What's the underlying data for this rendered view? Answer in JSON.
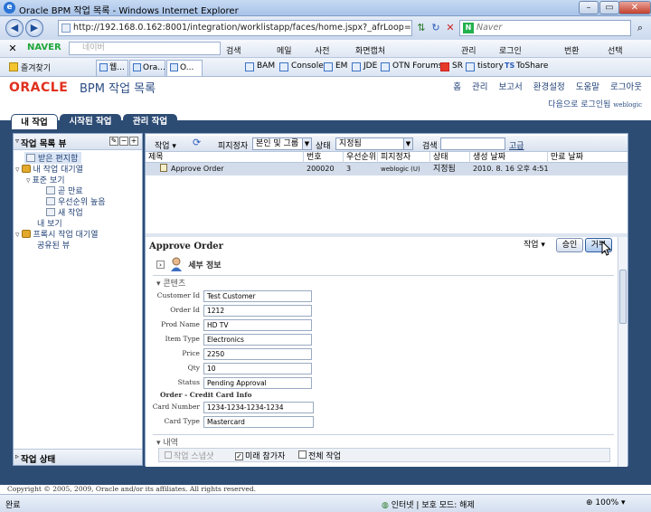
{
  "window": {
    "title": "Oracle BPM 작업 목록 - Windows Internet Explorer"
  },
  "browser": {
    "address": "http://192.168.0.162:8001/integration/worklistapp/faces/home.jspx?_afrLoop=30783009015746",
    "search_placeholder": "Naver",
    "naver_placeholder": "네이버",
    "naver_brand": "NAVER",
    "toolbar_items": [
      "검색",
      "메일",
      "사전",
      "화면캡처",
      "관리",
      "로그인",
      "번환",
      "선택"
    ],
    "fav_label": "즐겨찾기",
    "tabs": [
      "웹...",
      "Ora...",
      "O..."
    ],
    "favorites": [
      "BAM",
      "Console",
      "EM",
      "JDE",
      "OTN Forums",
      "SR",
      "tistory",
      "ToShare"
    ]
  },
  "app": {
    "logo": "ORACLE",
    "title": "BPM 작업 목록",
    "header_links": [
      "홈",
      "관리",
      "보고서",
      "환경설정",
      "도움말",
      "로그아웃"
    ],
    "logged_in_prefix": "다음으로 로그인됨",
    "logged_in_user": "weblogic",
    "main_tabs": [
      "내 작업",
      "시작된 작업",
      "관리 작업"
    ]
  },
  "left": {
    "header": "작업 목록 뷰",
    "footer": "작업 상태",
    "tree": [
      {
        "label": "받은 편지함",
        "selected": true
      },
      {
        "label": "내 작업 대기열"
      },
      {
        "label": "표준 보기"
      },
      {
        "label": "곧 만료"
      },
      {
        "label": "우선순위 높음"
      },
      {
        "label": "새 작업"
      },
      {
        "label": "내 보기"
      },
      {
        "label": "프록시 작업 대기열"
      },
      {
        "label": "공유된 뷰"
      }
    ]
  },
  "list": {
    "toolbar": {
      "actions": "작업",
      "assignee_label": "피지정자",
      "assignee_value": "본인 및 그룹",
      "status_label": "상태",
      "status_value": "지정됨",
      "search_label": "검색",
      "advanced": "고급"
    },
    "columns": [
      "제목",
      "번호",
      "우선순위",
      "피지정자",
      "상태",
      "생성 날짜",
      "만료 날짜"
    ],
    "rows": [
      {
        "title": "Approve Order",
        "number": "200020",
        "priority": "3",
        "assignee": "weblogic (U)",
        "status": "지정됨",
        "created": "2010. 8. 16 오후 4:51",
        "due": ""
      }
    ]
  },
  "detail": {
    "title": "Approve Order",
    "actions_label": "작업",
    "approve_button": "승인",
    "reject_button": "거부",
    "details_section": "세부 정보",
    "content_section": "콘텐츠",
    "fields": [
      {
        "label": "Customer Id",
        "value": "Test Customer"
      },
      {
        "label": "Order Id",
        "value": "1212"
      },
      {
        "label": "Prod Name",
        "value": "HD TV"
      },
      {
        "label": "Item Type",
        "value": "Electronics"
      },
      {
        "label": "Price",
        "value": "2250"
      },
      {
        "label": "Qty",
        "value": "10"
      },
      {
        "label": "Status",
        "value": "Pending Approval"
      }
    ],
    "credit_heading": "Order - Credit Card Info",
    "credit_fields": [
      {
        "label": "Card Number",
        "value": "1234-1234-1234-1234"
      },
      {
        "label": "Card Type",
        "value": "Mastercard"
      }
    ],
    "history_section": "내역",
    "history_snapshot": "작업 스냅샷",
    "history_future": "미래 참가자",
    "history_all": "전체 작업"
  },
  "footer": {
    "copyright": "Copyright © 2005, 2009, Oracle and/or its affiliates. All rights reserved."
  },
  "status": {
    "left": "완료",
    "zone": "인터넷 | 보호 모드: 해제",
    "zoom": "100%"
  }
}
